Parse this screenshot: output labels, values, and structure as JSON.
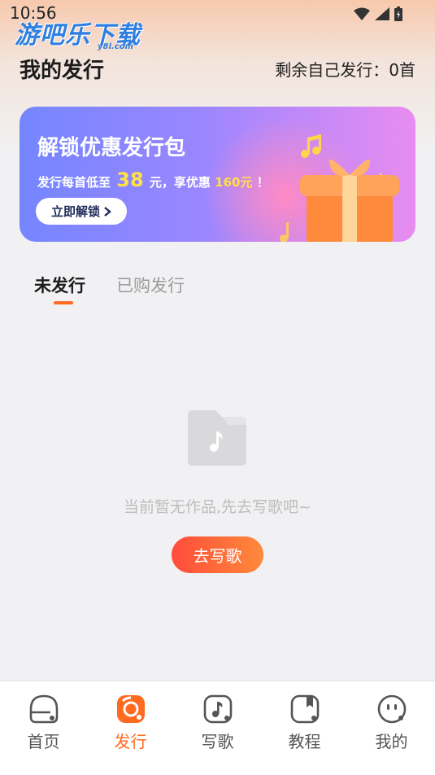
{
  "status_bar": {
    "time": "10:56"
  },
  "watermark": {
    "text": "游吧乐下载",
    "sub": "y8l.com"
  },
  "header": {
    "title": "我的发行",
    "remaining": "剩余自己发行：0首"
  },
  "banner": {
    "title": "解锁优惠发行包",
    "desc_prefix": "发行每首低至",
    "desc_price": "38",
    "desc_mid": "元，享优惠",
    "desc_amount": "160元",
    "desc_suffix": "！",
    "button_label": "立即解锁",
    "button_icon": "chevron-right-icon"
  },
  "tabs": [
    {
      "label": "未发行",
      "active": true
    },
    {
      "label": "已购发行",
      "active": false
    }
  ],
  "empty_state": {
    "icon": "music-folder-icon",
    "text": "当前暂无作品,先去写歌吧~",
    "button_label": "去写歌"
  },
  "tabbar": [
    {
      "label": "首页",
      "icon": "home-icon",
      "active": false
    },
    {
      "label": "发行",
      "icon": "publish-icon",
      "active": true
    },
    {
      "label": "写歌",
      "icon": "music-note-icon",
      "active": false
    },
    {
      "label": "教程",
      "icon": "tutorial-icon",
      "active": false
    },
    {
      "label": "我的",
      "icon": "profile-face-icon",
      "active": false
    }
  ],
  "colors": {
    "accent": "#ff6a21",
    "button_start": "#ff4c3b",
    "button_end": "#ff8a3a",
    "banner_start": "#7486ff",
    "banner_end": "#e88cf0"
  }
}
